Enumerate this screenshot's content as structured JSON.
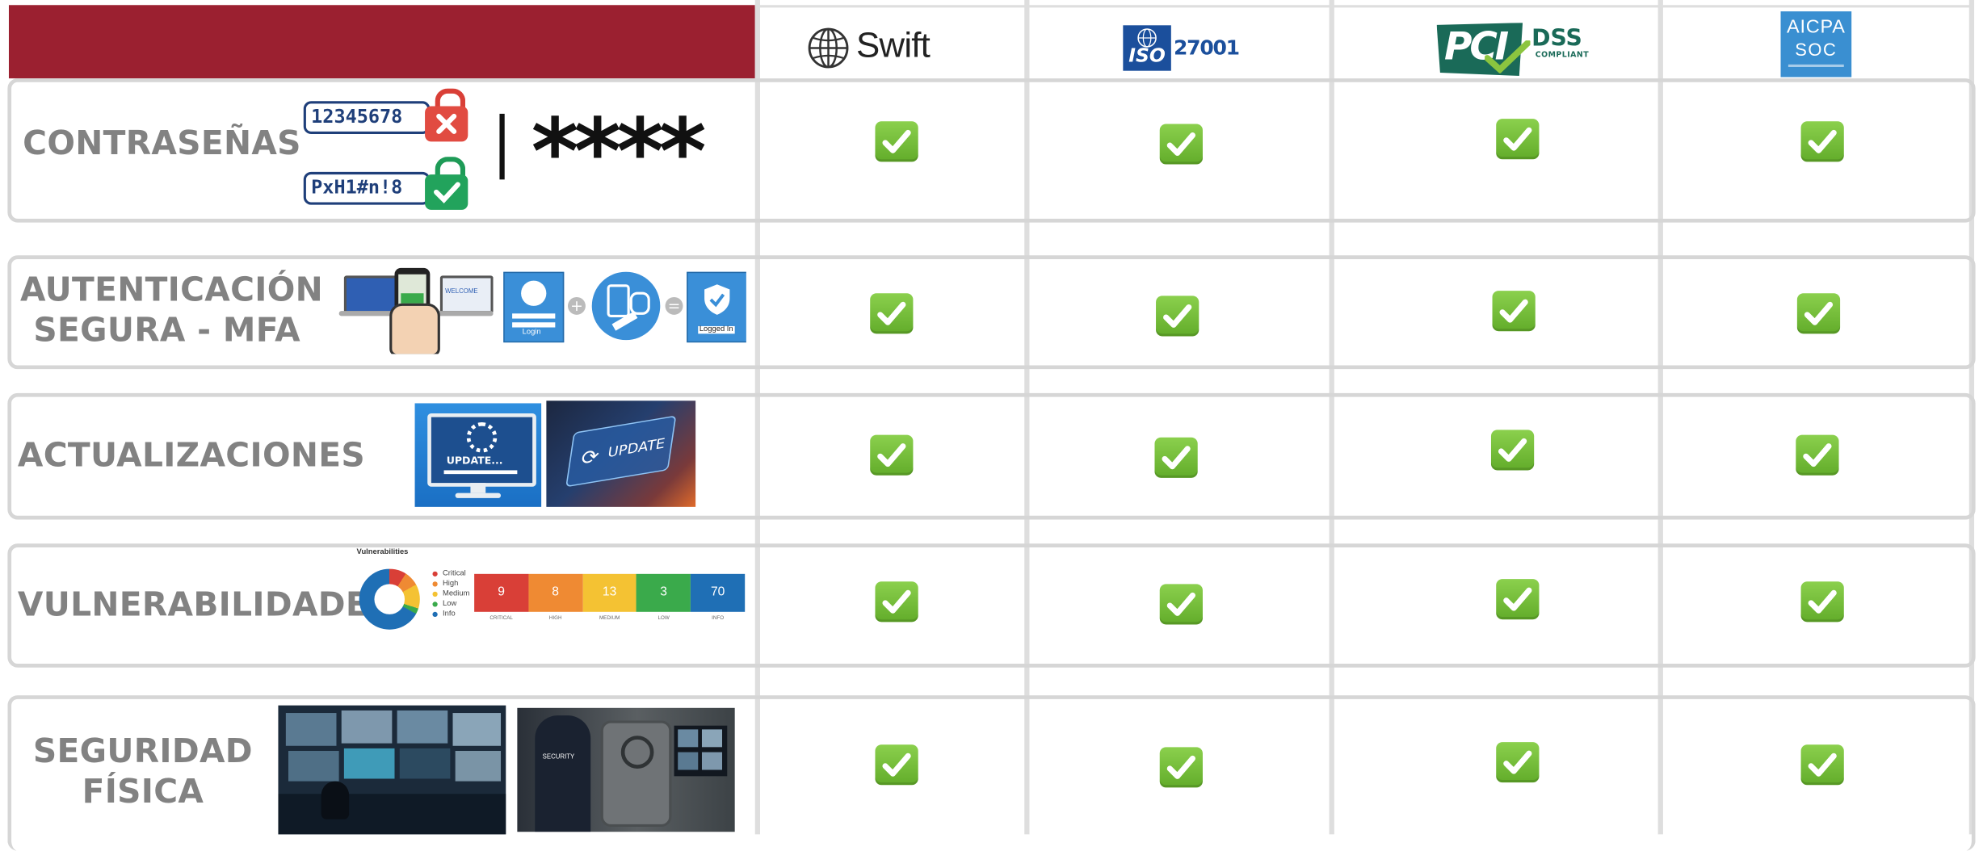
{
  "header": {
    "logos": [
      {
        "name": "swift-logo",
        "text": "Swift"
      },
      {
        "name": "iso-27001-logo",
        "badge_text": "ISO",
        "number_text": "27001"
      },
      {
        "name": "pci-dss-logo",
        "brand_text": "PCI",
        "line1": "DSS",
        "line2": "COMPLIANT"
      },
      {
        "name": "aicpa-soc-logo",
        "line1": "AICPA",
        "line2": "SOC"
      }
    ]
  },
  "rows": [
    {
      "label_lines": [
        "CONTRASEÑAS"
      ],
      "checks": [
        "✅",
        "✅",
        "✅",
        "✅"
      ]
    },
    {
      "label_lines": [
        "AUTENTICACIÓN",
        "SEGURA - MFA"
      ],
      "checks": [
        "✅",
        "✅",
        "✅",
        "✅"
      ]
    },
    {
      "label_lines": [
        "ACTUALIZACIONES"
      ],
      "checks": [
        "✅",
        "✅",
        "✅",
        "✅"
      ]
    },
    {
      "label_lines": [
        "VULNERABILIDADES"
      ],
      "checks": [
        "✅",
        "✅",
        "✅",
        "✅"
      ]
    },
    {
      "label_lines": [
        "SEGURIDAD",
        "FÍSICA"
      ],
      "checks": [
        "✅",
        "✅",
        "✅",
        "✅"
      ]
    }
  ],
  "illustrations": {
    "passwords": {
      "weak": "12345678",
      "strong": "PxH1#n!8",
      "masked": "****"
    },
    "mfa": {
      "login_label": "Login",
      "logged_in_label": "Logged In",
      "welcome": "WELCOME"
    },
    "updates": {
      "monitor_text": "UPDATE...",
      "key_text": "UPDATE"
    },
    "vulnerabilities": {
      "title": "Vulnerabilities",
      "legend": [
        "Critical",
        "High",
        "Medium",
        "Low",
        "Info"
      ],
      "counts": [
        {
          "value": "9",
          "label": "CRITICAL",
          "color": "#d93f37"
        },
        {
          "value": "8",
          "label": "HIGH",
          "color": "#ef8a33"
        },
        {
          "value": "13",
          "label": "MEDIUM",
          "color": "#f4c233"
        },
        {
          "value": "3",
          "label": "LOW",
          "color": "#3aaa4b"
        },
        {
          "value": "70",
          "label": "INFO",
          "color": "#1f6fb5"
        }
      ]
    },
    "physical": {
      "guard_text": "SECURITY"
    }
  },
  "colors": {
    "header_red": "#9b2030",
    "label_gray": "#828282",
    "border_gray": "#d6d6d6",
    "check_green": "#74bd3a"
  }
}
